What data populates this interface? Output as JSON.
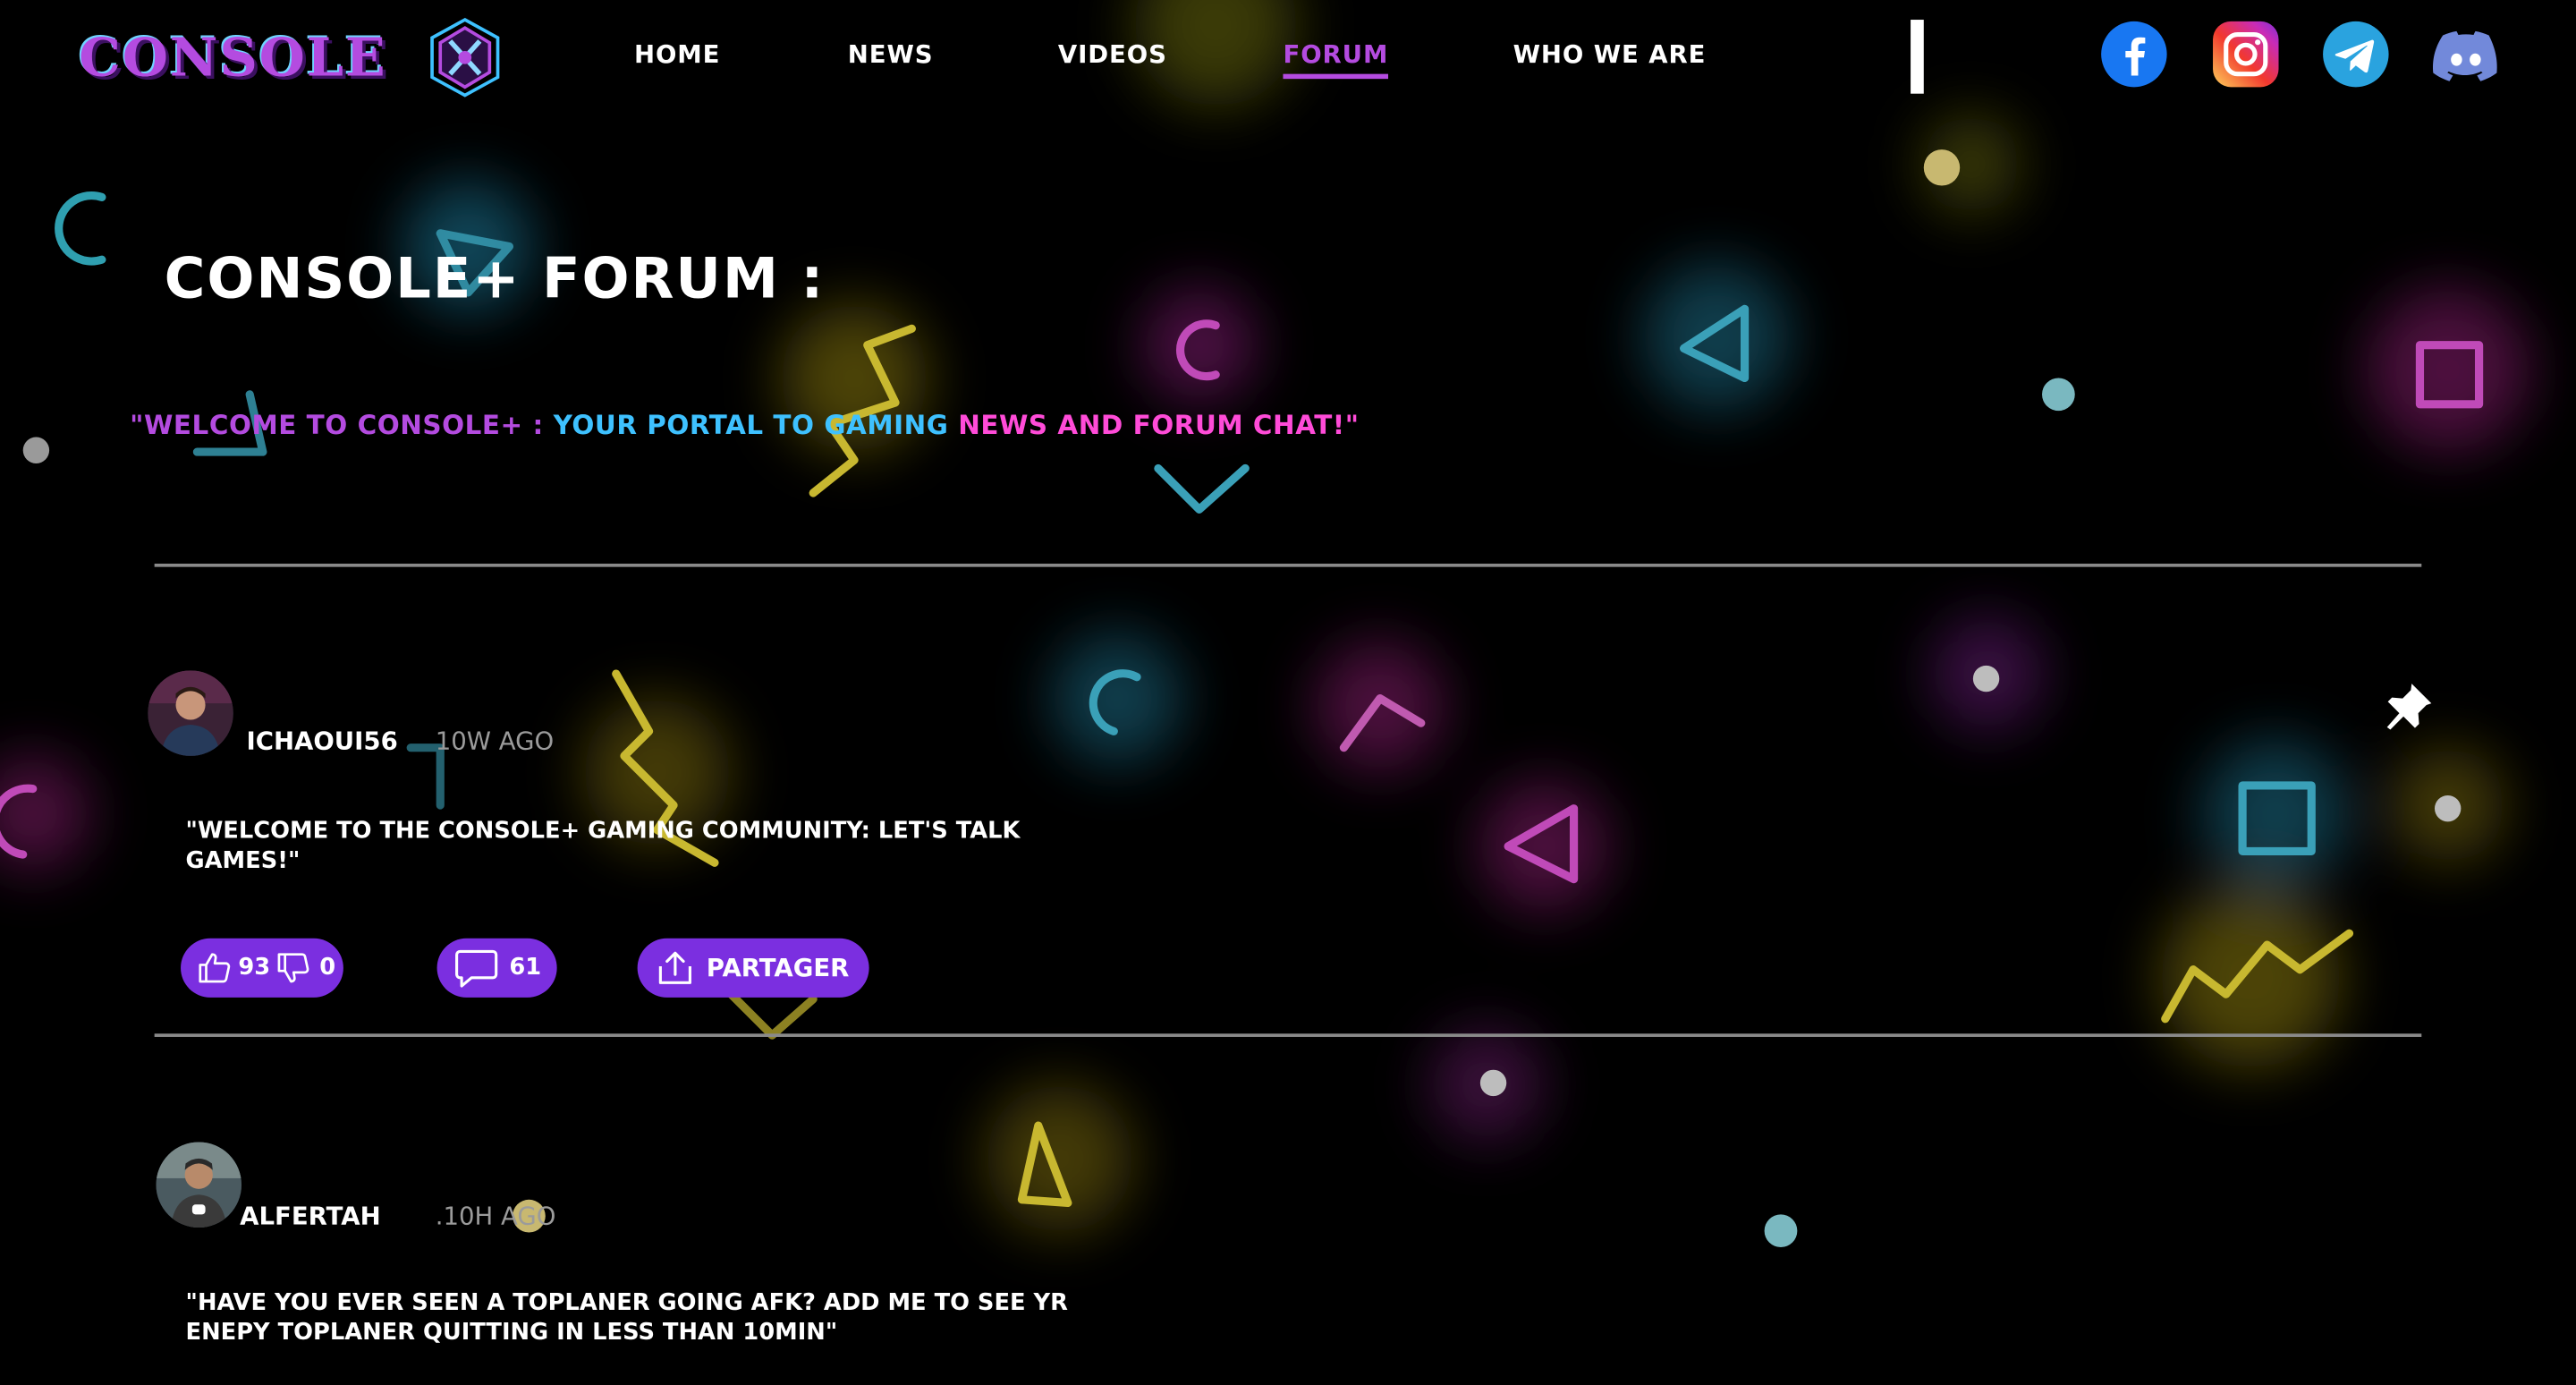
{
  "app": {
    "logo_text": "CONSOLE"
  },
  "nav": {
    "items": [
      {
        "label": "HOME",
        "active": false
      },
      {
        "label": "NEWS",
        "active": false
      },
      {
        "label": "VIDEOS",
        "active": false
      },
      {
        "label": "FORUM",
        "active": true
      },
      {
        "label": "WHO WE ARE",
        "active": false
      }
    ]
  },
  "social": [
    {
      "icon": "facebook-icon",
      "color": "#1877f2"
    },
    {
      "icon": "instagram-icon",
      "color": "#e1306c"
    },
    {
      "icon": "telegram-icon",
      "color": "#2aa3df"
    },
    {
      "icon": "discord-icon",
      "color": "#7289da"
    }
  ],
  "page": {
    "title": "CONSOLE+ FORUM :",
    "tagline": {
      "part1": "\"WELCOME TO CONSOLE+ : ",
      "part2": "YOUR PORTAL TO GAMING ",
      "part3": "NEWS AND FORUM CHAT!\""
    }
  },
  "colors": {
    "accent_purple": "#7b2fe0",
    "tag_purple": "#b44be0",
    "tag_blue": "#3ec1ff",
    "tag_pink": "#ff4bd8"
  },
  "posts": [
    {
      "username": "ICHAOUI56",
      "time": "10W AGO",
      "text": "\"WELCOME TO THE CONSOLE+ GAMING COMMUNITY: LET'S TALK GAMES!\"",
      "likes": "93",
      "dislikes": "0",
      "comments": "61",
      "share_label": "PARTAGER",
      "pinned": true
    },
    {
      "username": "ALFERTAH",
      "time": ".10H AGO",
      "text": "\"HAVE YOU EVER SEEN A TOPLANER GOING AFK? ADD ME TO SEE YR ENEPY TOPLANER QUITTING IN LESS THAN 10MIN\""
    }
  ]
}
